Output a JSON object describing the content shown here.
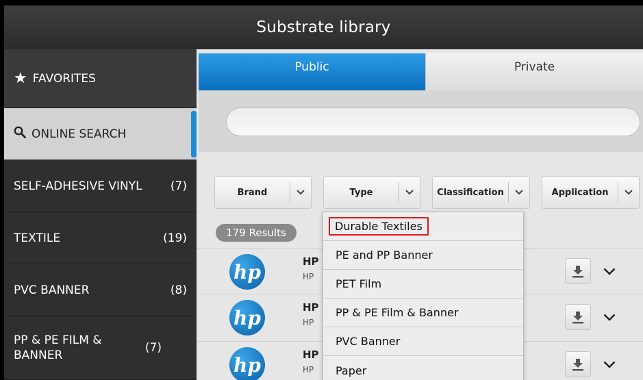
{
  "window": {
    "title": "Substrate library"
  },
  "sidebar": {
    "favorites": {
      "label": "FAVORITES",
      "icon": "star-icon"
    },
    "online_search": {
      "label": "ONLINE SEARCH",
      "icon": "search-icon"
    },
    "items": [
      {
        "label": "SELF-ADHESIVE VINYL",
        "count": "(7)"
      },
      {
        "label": "TEXTILE",
        "count": "(19)"
      },
      {
        "label": "PVC BANNER",
        "count": "(8)"
      },
      {
        "label": "PP & PE FILM & BANNER",
        "count": "(7)"
      }
    ]
  },
  "tabs": {
    "public": "Public",
    "private": "Private"
  },
  "search": {
    "value": "",
    "placeholder": ""
  },
  "filters": {
    "brand": "Brand",
    "type": "Type",
    "classification": "Classification",
    "application": "Application"
  },
  "results": {
    "label": "179 Results"
  },
  "rows": [
    {
      "logo": "hp",
      "title": "HP",
      "subtitle": "HP"
    },
    {
      "logo": "hp",
      "title": "HP",
      "subtitle": "HP"
    },
    {
      "logo": "hp",
      "title": "HP",
      "subtitle": "HP"
    }
  ],
  "type_dropdown": {
    "options": [
      "Durable Textiles",
      "PE and PP Banner",
      "PET Film",
      "PP & PE Film & Banner",
      "PVC Banner",
      "Paper"
    ],
    "highlighted": "Durable Textiles"
  },
  "colors": {
    "accent": "#0a6fc0",
    "highlight_border": "#e01818",
    "sidebar_bg": "#2f2f2f"
  }
}
